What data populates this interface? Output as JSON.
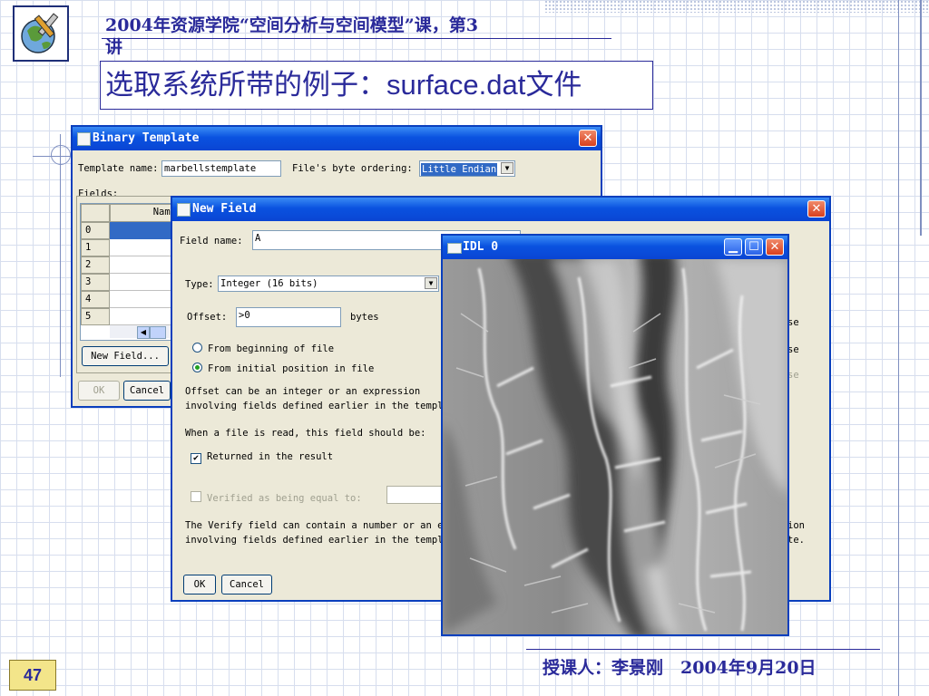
{
  "slide": {
    "title_line1": "2004年资源学院“空间分析与空间模型”课，第3",
    "title_line1_cont": "讲",
    "title_prefix": "选取系统所带的例子：",
    "title_filename": "surface.dat",
    "title_suffix": "文件",
    "footer": "授课人：李景刚　2004年9月20日",
    "page_number": "47",
    "logo_icon": "globe-wrench-icon"
  },
  "binary_template": {
    "title": "Binary Template",
    "template_name_label": "Template name:",
    "template_name_value": "marbellstemplate",
    "byte_order_label": "File's byte ordering:",
    "byte_order_value": "Little Endian",
    "fields_label": "Fields:",
    "column_name": "Name",
    "rows": [
      "0",
      "1",
      "2",
      "3",
      "4",
      "5"
    ],
    "new_field_button": "New Field...",
    "ok_button": "OK",
    "cancel_button": "Cancel"
  },
  "new_field": {
    "title": "New Field",
    "field_name_label": "Field name:",
    "field_name_value": "A",
    "type_label": "Type:",
    "type_value": "Integer (16 bits)",
    "offset_label": "Offset:",
    "offset_value": ">0",
    "offset_unit": "bytes",
    "radio_from_beginning": "From beginning of file",
    "radio_from_initial": "From initial position in file",
    "offset_help_1": "Offset can be an integer or an expression",
    "offset_help_2": "involving fields defined earlier in the templ",
    "read_label": "When a file is read, this field should be:",
    "returned_label": "Returned in the result",
    "verified_label": "Verified as being equal to:",
    "verify_help_1": "The Verify field can contain a number or an e",
    "verify_help_2": "involving fields defined earlier in the templ",
    "right_fragments": [
      "se",
      "se",
      "se",
      "ion",
      "te."
    ],
    "ok_button": "OK",
    "cancel_button": "Cancel"
  },
  "idl_window": {
    "title": "IDL 0"
  }
}
